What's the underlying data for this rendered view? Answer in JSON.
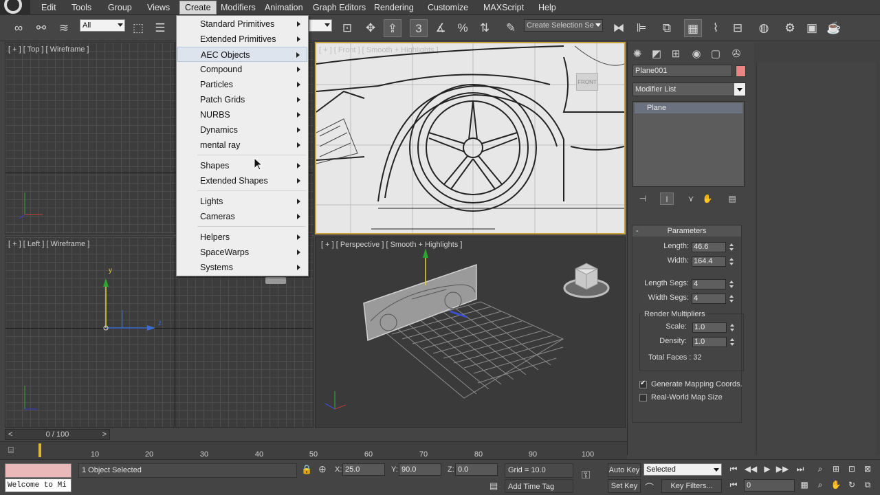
{
  "menubar": {
    "items": [
      "Edit",
      "Tools",
      "Group",
      "Views",
      "Create",
      "Modifiers",
      "Animation",
      "Graph Editors",
      "Rendering",
      "Customize",
      "MAXScript",
      "Help"
    ],
    "active": "Create"
  },
  "toolbar": {
    "selection_filter": "All",
    "named_selection_placeholder": "Create Selection Se",
    "snap_label": "3"
  },
  "create_menu": {
    "items": [
      {
        "label": "Standard Primitives",
        "submenu": true
      },
      {
        "label": "Extended Primitives",
        "submenu": true
      },
      {
        "label": "AEC Objects",
        "submenu": true,
        "highlighted": true
      },
      {
        "label": "Compound",
        "submenu": true
      },
      {
        "label": "Particles",
        "submenu": true
      },
      {
        "label": "Patch Grids",
        "submenu": true
      },
      {
        "label": "NURBS",
        "submenu": true
      },
      {
        "label": "Dynamics",
        "submenu": true
      },
      {
        "label": "mental ray",
        "submenu": true
      },
      {
        "label": "Shapes",
        "submenu": true
      },
      {
        "label": "Extended Shapes",
        "submenu": true
      },
      {
        "label": "Lights",
        "submenu": true
      },
      {
        "label": "Cameras",
        "submenu": true
      },
      {
        "label": "Helpers",
        "submenu": true
      },
      {
        "label": "SpaceWarps",
        "submenu": true
      },
      {
        "label": "Systems",
        "submenu": true
      }
    ]
  },
  "viewports": {
    "top": "[ + ] [ Top ] [ Wireframe ]",
    "front": "[ + ] [ Front ] [ Smooth + Highlights ]",
    "left": "[ + ] [ Left ] [ Wireframe ]",
    "perspective": "[ + ] [ Perspective ] [ Smooth + Highlights ]",
    "viewcube_front_label": "FRONT",
    "axis_x": "x",
    "axis_y": "y",
    "axis_z": "z"
  },
  "command_panel": {
    "object_name": "Plane001",
    "object_color": "#e98585",
    "modifier_list": "Modifier List",
    "stack_item": "Plane",
    "parameters": {
      "title": "Parameters",
      "length_label": "Length:",
      "length": "46.6",
      "width_label": "Width:",
      "width": "164.4",
      "length_segs_label": "Length Segs:",
      "length_segs": "4",
      "width_segs_label": "Width Segs:",
      "width_segs": "4",
      "render_multipliers": "Render Multipliers",
      "scale_label": "Scale:",
      "scale": "1.0",
      "density_label": "Density:",
      "density": "1.0",
      "total_faces": "Total Faces : 32",
      "generate_mapping": "Generate Mapping Coords.",
      "generate_mapping_checked": true,
      "real_world": "Real-World Map Size",
      "real_world_checked": false
    }
  },
  "timeline": {
    "frame": "0 / 100",
    "ticks": [
      "10",
      "20",
      "30",
      "40",
      "50",
      "60",
      "70",
      "80",
      "90",
      "100"
    ]
  },
  "status": {
    "listener_text": "Welcome to Mi",
    "selection": "1 Object Selected",
    "x_label": "X:",
    "x": "25.0",
    "y_label": "Y:",
    "y": "90.0",
    "z_label": "Z:",
    "z": "0.0",
    "grid": "Grid = 10.0",
    "add_time_tag": "Add Time Tag",
    "auto_key": "Auto Key",
    "set_key": "Set Key",
    "key_mode": "Selected",
    "key_filters": "Key Filters...",
    "current_frame": "0"
  }
}
